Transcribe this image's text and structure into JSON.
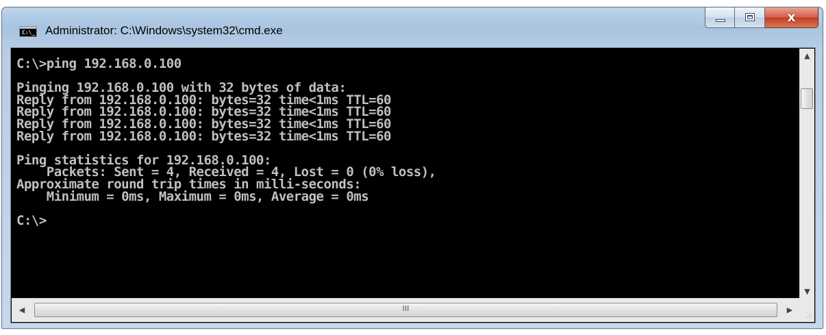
{
  "window": {
    "title": "Administrator: C:\\Windows\\system32\\cmd.exe",
    "icon_text": "C:\\_",
    "close_glyph": "x",
    "colors": {
      "console_bg": "#000000",
      "console_fg": "#c0c0c0",
      "close_red": "#c23c24"
    }
  },
  "console": {
    "lines": [
      "C:\\>ping 192.168.0.100",
      "",
      "Pinging 192.168.0.100 with 32 bytes of data:",
      "Reply from 192.168.0.100: bytes=32 time<1ms TTL=60",
      "Reply from 192.168.0.100: bytes=32 time<1ms TTL=60",
      "Reply from 192.168.0.100: bytes=32 time<1ms TTL=60",
      "Reply from 192.168.0.100: bytes=32 time<1ms TTL=60",
      "",
      "Ping statistics for 192.168.0.100:",
      "    Packets: Sent = 4, Received = 4, Lost = 0 (0% loss),",
      "Approximate round trip times in milli-seconds:",
      "    Minimum = 0ms, Maximum = 0ms, Average = 0ms",
      "",
      "C:\\>"
    ]
  },
  "scrollbars": {
    "up_arrow": "▲",
    "down_arrow": "▼",
    "left_arrow": "◀",
    "right_arrow": "▶",
    "h_grip": "III",
    "size_grip": ".::"
  }
}
